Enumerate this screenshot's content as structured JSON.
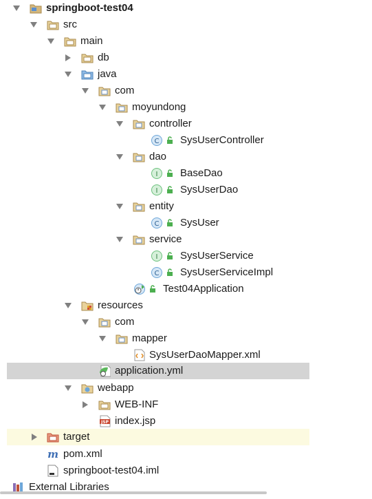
{
  "tree": {
    "project": "springboot-test04",
    "src": "src",
    "main": "main",
    "db": "db",
    "java": "java",
    "com": "com",
    "moyundong": "moyundong",
    "controller": "controller",
    "SysUserController": "SysUserController",
    "dao": "dao",
    "BaseDao": "BaseDao",
    "SysUserDao": "SysUserDao",
    "entity": "entity",
    "SysUser": "SysUser",
    "service": "service",
    "SysUserService": "SysUserService",
    "SysUserServiceImpl": "SysUserServiceImpl",
    "Test04Application": "Test04Application",
    "resources": "resources",
    "res_com": "com",
    "mapper": "mapper",
    "mapperXml": "SysUserDaoMapper.xml",
    "applicationYml": "application.yml",
    "webapp": "webapp",
    "webinf": "WEB-INF",
    "indexJsp": "index.jsp",
    "target": "target",
    "pom": "pom.xml",
    "iml": "springboot-test04.iml",
    "extLibs": "External Libraries"
  },
  "icons": {
    "class_badge": "C",
    "interface_badge": "I",
    "maven_badge": "m",
    "jsp_badge": "JSP"
  },
  "colors": {
    "selected_row": "#d4d4d4",
    "highlight_row": "#fcfae0",
    "folder": "#d3b77d",
    "source_folder": "#6fa3d6",
    "class_circle": "#6da6d9",
    "interface_circle": "#6cc17d",
    "target_folder": "#d66a4a",
    "lock": "#4caf50"
  }
}
